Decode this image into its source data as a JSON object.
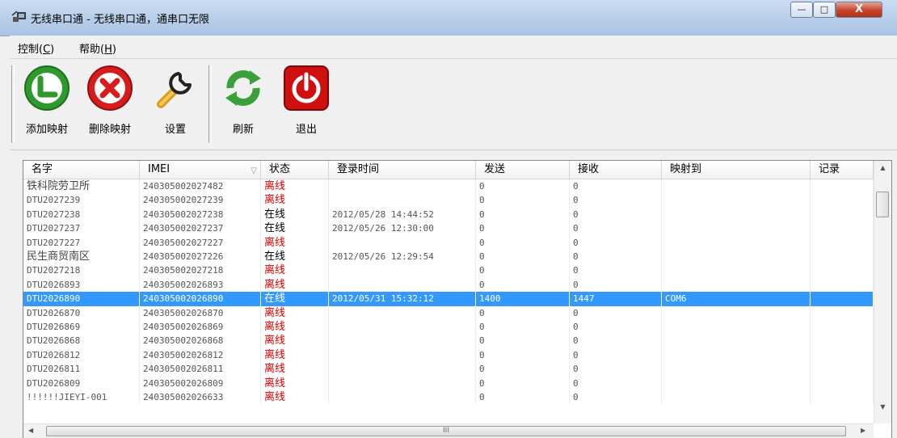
{
  "window": {
    "title": "无线串口通 - 无线串口通，通串口无限",
    "min_glyph": "—",
    "max_glyph": "□",
    "close_glyph": "X"
  },
  "menu": [
    {
      "label": "控制",
      "hotkey": "C"
    },
    {
      "label": "帮助",
      "hotkey": "H"
    }
  ],
  "toolbar": {
    "add_label": "添加映射",
    "delete_label": "删除映射",
    "settings_label": "设置",
    "refresh_label": "刷新",
    "exit_label": "退出"
  },
  "colors": {
    "add": "#2e9a2e",
    "delete": "#d81c1c",
    "refresh": "#3aa03a",
    "exit": "#d01010",
    "offline_text": "#e00000",
    "selection": "#3399ff"
  },
  "list": {
    "columns": [
      "名字",
      "IMEI",
      "状态",
      "登录时间",
      "发送",
      "接收",
      "映射到",
      "记录"
    ],
    "sort_icon": "▽",
    "rows": [
      {
        "name": "铁科院劳卫所",
        "imei": "240305002027482",
        "status": "离线",
        "login": "",
        "sent": "0",
        "recv": "0",
        "map": ""
      },
      {
        "name": "DTU2027239",
        "imei": "240305002027239",
        "status": "离线",
        "login": "",
        "sent": "0",
        "recv": "0",
        "map": ""
      },
      {
        "name": "DTU2027238",
        "imei": "240305002027238",
        "status": "在线",
        "login": "2012/05/28 14:44:52",
        "sent": "0",
        "recv": "0",
        "map": ""
      },
      {
        "name": "DTU2027237",
        "imei": "240305002027237",
        "status": "在线",
        "login": "2012/05/26 12:30:00",
        "sent": "0",
        "recv": "0",
        "map": ""
      },
      {
        "name": "DTU2027227",
        "imei": "240305002027227",
        "status": "离线",
        "login": "",
        "sent": "0",
        "recv": "0",
        "map": ""
      },
      {
        "name": "民生商贸南区",
        "imei": "240305002027226",
        "status": "在线",
        "login": "2012/05/26 12:29:54",
        "sent": "0",
        "recv": "0",
        "map": ""
      },
      {
        "name": "DTU2027218",
        "imei": "240305002027218",
        "status": "离线",
        "login": "",
        "sent": "0",
        "recv": "0",
        "map": ""
      },
      {
        "name": "DTU2026893",
        "imei": "240305002026893",
        "status": "离线",
        "login": "",
        "sent": "0",
        "recv": "0",
        "map": ""
      },
      {
        "name": "DTU2026890",
        "imei": "240305002026890",
        "status": "在线",
        "login": "2012/05/31 15:32:12",
        "sent": "1400",
        "recv": "1447",
        "map": "COM6",
        "selected": true
      },
      {
        "name": "DTU2026870",
        "imei": "240305002026870",
        "status": "离线",
        "login": "",
        "sent": "0",
        "recv": "0",
        "map": ""
      },
      {
        "name": "DTU2026869",
        "imei": "240305002026869",
        "status": "离线",
        "login": "",
        "sent": "0",
        "recv": "0",
        "map": ""
      },
      {
        "name": "DTU2026868",
        "imei": "240305002026868",
        "status": "离线",
        "login": "",
        "sent": "0",
        "recv": "0",
        "map": ""
      },
      {
        "name": "DTU2026812",
        "imei": "240305002026812",
        "status": "离线",
        "login": "",
        "sent": "0",
        "recv": "0",
        "map": ""
      },
      {
        "name": "DTU2026811",
        "imei": "240305002026811",
        "status": "离线",
        "login": "",
        "sent": "0",
        "recv": "0",
        "map": ""
      },
      {
        "name": "DTU2026809",
        "imei": "240305002026809",
        "status": "离线",
        "login": "",
        "sent": "0",
        "recv": "0",
        "map": ""
      },
      {
        "name": "!!!!!!JIEYI-001",
        "imei": "240305002026633",
        "status": "离线",
        "login": "",
        "sent": "0",
        "recv": "0",
        "map": ""
      }
    ]
  },
  "scrollbar": {
    "up": "▲",
    "down": "▼",
    "left": "◀",
    "right": "▶",
    "grip": "III"
  }
}
